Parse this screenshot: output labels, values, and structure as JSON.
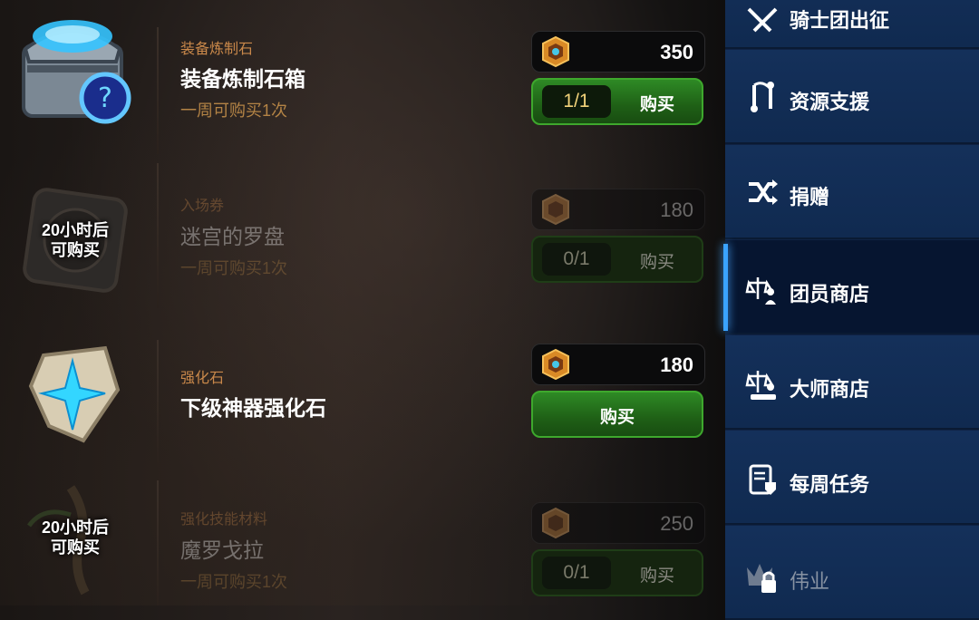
{
  "shop_items": [
    {
      "category": "装备炼制石",
      "name": "装备炼制石箱",
      "limit_text": "一周可购买1次",
      "price": "350",
      "count": "1/1",
      "buy_label": "购买",
      "available": true
    },
    {
      "category": "入场券",
      "name": "迷宫的罗盘",
      "limit_text": "一周可购买1次",
      "price": "180",
      "count": "0/1",
      "buy_label": "购买",
      "available": false,
      "lock_line1": "20小时后",
      "lock_line2": "可购买"
    },
    {
      "category": "强化石",
      "name": "下级神器强化石",
      "price": "180",
      "buy_label": "购买",
      "available": true
    },
    {
      "category": "强化技能材料",
      "name": "魔罗戈拉",
      "limit_text": "一周可购买1次",
      "price": "250",
      "count": "0/1",
      "buy_label": "购买",
      "available": false,
      "lock_line1": "20小时后",
      "lock_line2": "可购买"
    }
  ],
  "sidebar": {
    "items": [
      {
        "label": "骑士团出征",
        "icon": "swords-icon"
      },
      {
        "label": "资源支援",
        "icon": "transfer-icon"
      },
      {
        "label": "捐赠",
        "icon": "shuffle-icon"
      },
      {
        "label": "团员商店",
        "icon": "member-shop-icon",
        "active": true
      },
      {
        "label": "大师商店",
        "icon": "master-shop-icon"
      },
      {
        "label": "每周任务",
        "icon": "scroll-icon"
      },
      {
        "label": "伟业",
        "icon": "crown-lock-icon",
        "disabled": true
      }
    ]
  },
  "colors": {
    "accent": "#3aa3ff",
    "buy_green": "#2e8a25",
    "category": "#c9884a"
  }
}
